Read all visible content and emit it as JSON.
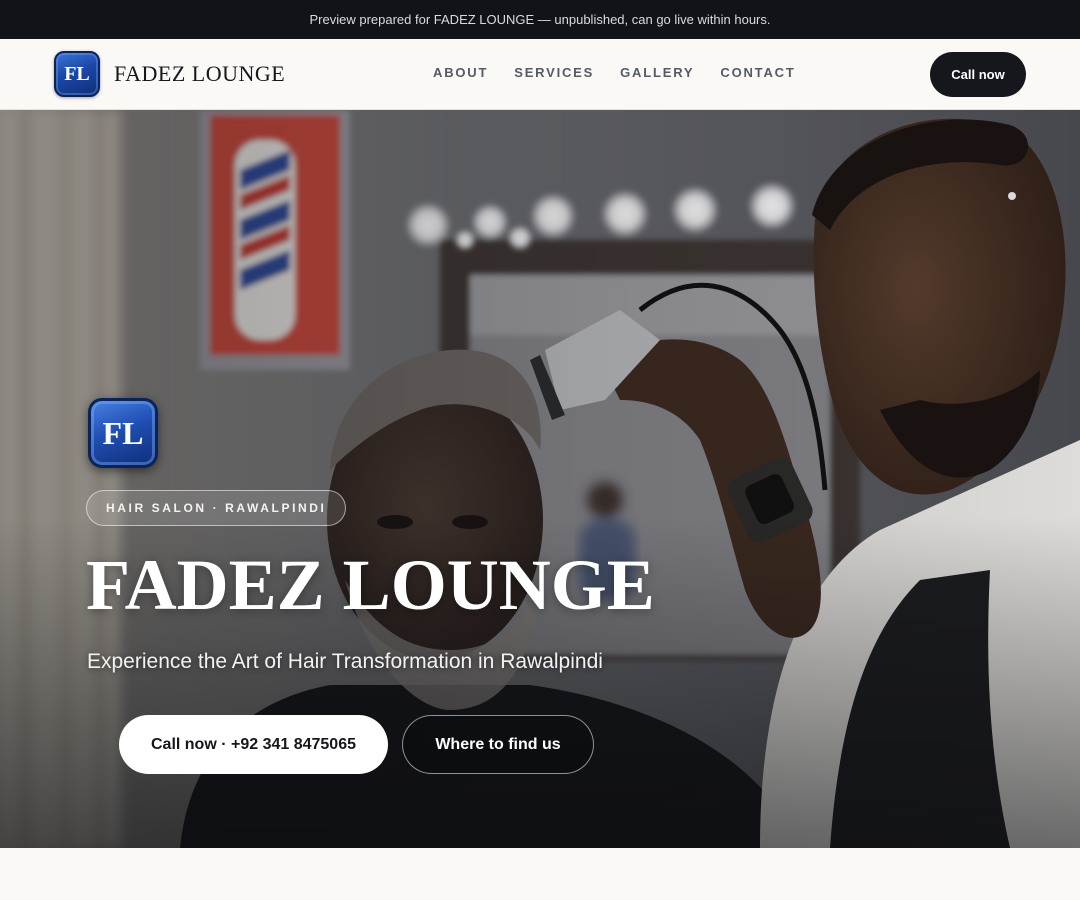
{
  "preview_bar": {
    "text": "Preview prepared for FADEZ LOUNGE — unpublished, can go live within hours."
  },
  "header": {
    "logo_text": "FL",
    "brand": "FADEZ LOUNGE",
    "nav": [
      "ABOUT",
      "SERVICES",
      "GALLERY",
      "CONTACT"
    ],
    "cta": "Call now"
  },
  "hero": {
    "logo_text": "FL",
    "tag": "HAIR SALON · RAWALPINDI",
    "title": "FADEZ LOUNGE",
    "subtitle": "Experience the Art of Hair Transformation in Rawalpindi",
    "call_button": "Call now · +92 341 8475065",
    "find_button": "Where to find us"
  },
  "colors": {
    "dark": "#15171c",
    "preview_bar_bg": "#111318",
    "page_bg": "#faf9f6",
    "logo_blue": "#1b47a8"
  }
}
